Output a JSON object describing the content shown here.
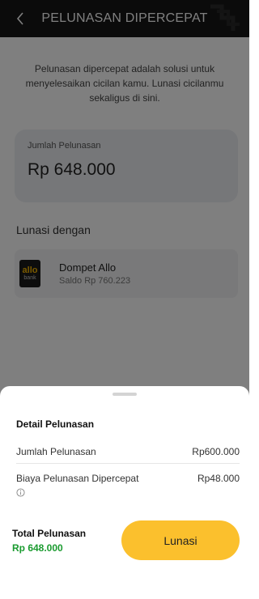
{
  "header": {
    "title": "PELUNASAN DIPERCEPAT",
    "back_icon": "chevron-left-icon"
  },
  "intro": {
    "text": "Pelunasan dipercepat adalah solusi untuk menyelesaikan cicilan kamu. Lunasi cicilanmu sekaligus di sini."
  },
  "summary_card": {
    "label": "Jumlah Pelunasan",
    "amount": "Rp 648.000"
  },
  "payment_method": {
    "section_label": "Lunasi dengan",
    "logo_line1": "allo",
    "logo_line2": "bank",
    "name": "Dompet Allo",
    "balance": "Saldo Rp 760.223"
  },
  "sheet": {
    "title": "Detail Pelunasan",
    "rows": [
      {
        "label": "Jumlah Pelunasan",
        "value": "Rp600.000"
      },
      {
        "label": "Biaya Pelunasan Dipercepat",
        "value": "Rp48.000"
      }
    ],
    "total_label": "Total Pelunasan",
    "total_amount": "Rp 648.000",
    "pay_button": "Lunasi"
  },
  "colors": {
    "accent": "#fbc02d",
    "total_green": "#1a9b2f",
    "header_bg": "#161616"
  }
}
